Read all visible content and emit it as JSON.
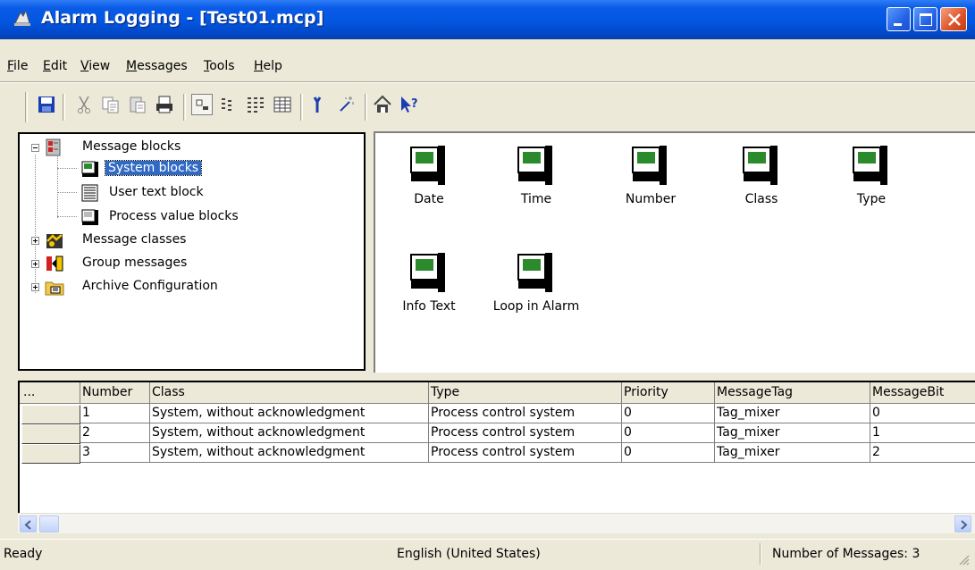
{
  "window": {
    "title": "Alarm Logging - [Test01.mcp]"
  },
  "menu": [
    "File",
    "Edit",
    "View",
    "Messages",
    "Tools",
    "Help"
  ],
  "toolbar": {
    "buttons": [
      "save-icon",
      "cut-icon",
      "copy-icon",
      "paste-icon",
      "print-icon",
      "large-icons-view-icon",
      "small-icons-view-icon",
      "list-view-icon",
      "details-view-icon",
      "properties-icon",
      "wizard-icon",
      "info-icon",
      "help-pointer-icon"
    ]
  },
  "tree": {
    "items": [
      {
        "label": "Message blocks",
        "level": 0,
        "expanded": true
      },
      {
        "label": "System blocks",
        "level": 1,
        "selected": true
      },
      {
        "label": "User text block",
        "level": 1
      },
      {
        "label": "Process value blocks",
        "level": 1
      },
      {
        "label": "Message classes",
        "level": 0,
        "expanded": false
      },
      {
        "label": "Group messages",
        "level": 0,
        "expanded": false
      },
      {
        "label": "Archive Configuration",
        "level": 0,
        "expanded": false
      }
    ]
  },
  "blocks": [
    "Date",
    "Time",
    "Number",
    "Class",
    "Type",
    "Info Text",
    "Loop in Alarm"
  ],
  "table": {
    "columns": [
      "...",
      "Number",
      "Class",
      "Type",
      "Priority",
      "MessageTag",
      "MessageBit"
    ],
    "rows": [
      [
        "",
        "1",
        "System, without acknowledgment",
        "Process control system",
        "0",
        "Tag_mixer",
        "0"
      ],
      [
        "",
        "2",
        "System, without acknowledgment",
        "Process control system",
        "0",
        "Tag_mixer",
        "1"
      ],
      [
        "",
        "3",
        "System, without acknowledgment",
        "Process control system",
        "0",
        "Tag_mixer",
        "2"
      ]
    ]
  },
  "status": {
    "left": "Ready",
    "language": "English (United States)",
    "count": "Number of Messages: 3"
  }
}
